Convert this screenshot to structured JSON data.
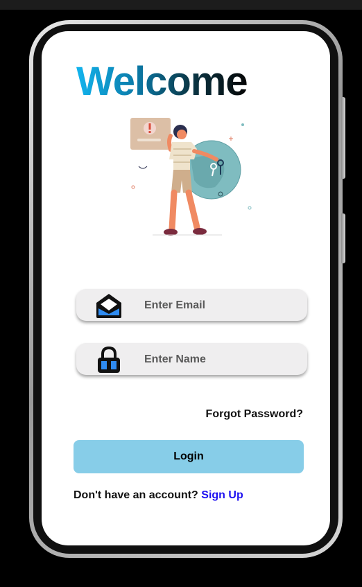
{
  "screen": {
    "title": "Welcome",
    "email_field": {
      "placeholder": "Enter Email",
      "icon": "mail-icon"
    },
    "name_field": {
      "placeholder": "Enter Name",
      "icon": "lock-icon"
    },
    "forgot_password": "Forgot Password?",
    "login_button": "Login",
    "signup_prompt": "Don't have an account?",
    "signup_link": "Sign Up"
  },
  "colors": {
    "title_gradient_start": "#12b4ee",
    "title_gradient_end": "#050505",
    "login_button_bg": "#87cde8",
    "signup_link": "#1d10f0",
    "field_bg": "#efeeef",
    "icon_accent": "#2f8cf2"
  },
  "illustration": {
    "name": "woman-with-keys-illustration"
  }
}
